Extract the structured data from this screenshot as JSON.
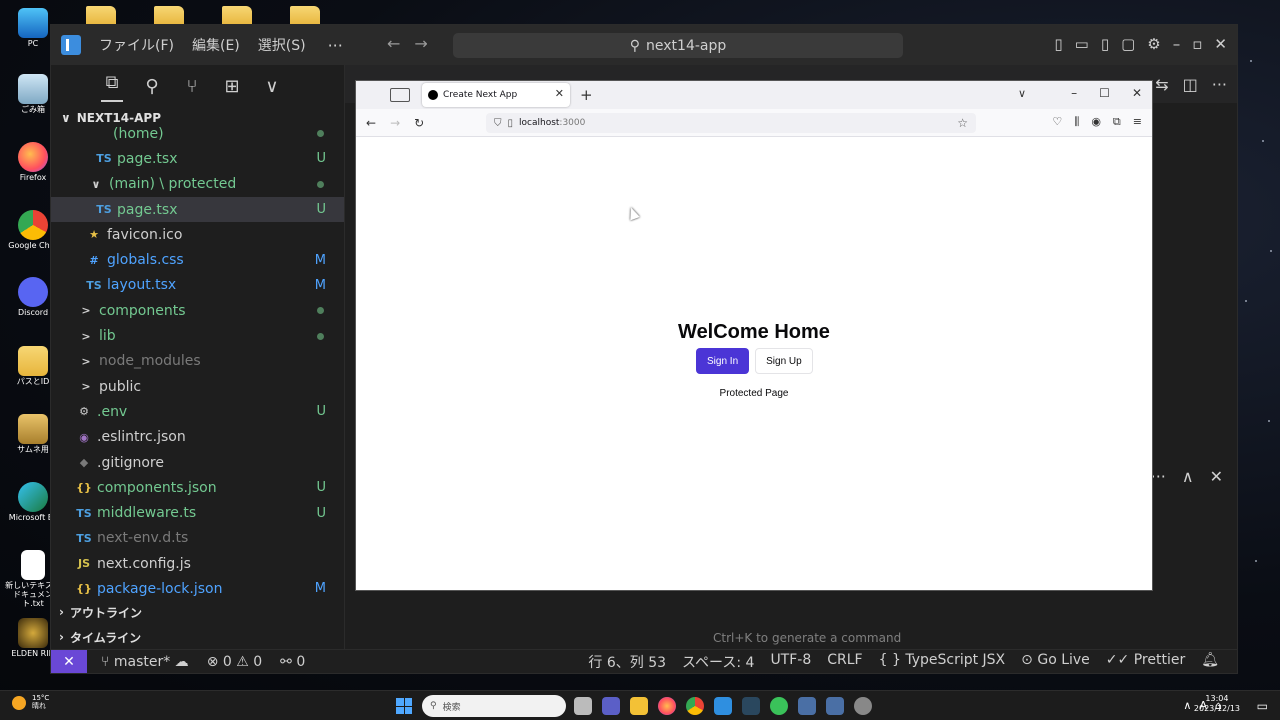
{
  "desktop": {
    "icons": [
      {
        "label": "PC"
      },
      {
        "label": "ごみ箱"
      },
      {
        "label": "Firefox"
      },
      {
        "label": "Google Chro"
      },
      {
        "label": "Discord"
      },
      {
        "label": "パスとID"
      },
      {
        "label": "サムネ用"
      },
      {
        "label": "Microsoft Ec"
      },
      {
        "label": "新しいテキスト ドキュメント.txt"
      },
      {
        "label": "ELDEN RIN"
      }
    ]
  },
  "vscode": {
    "menu": [
      "ファイル(F)",
      "編集(E)",
      "選択(S)"
    ],
    "menu_more": "···",
    "command_center": "next14-app",
    "explorer_title": "NEXT14-APP",
    "tree": [
      {
        "icon": "",
        "label": "(home)",
        "badge": "",
        "color": "green",
        "indent": 40,
        "dot": true
      },
      {
        "icon": "TS",
        "label": "page.tsx",
        "badge": "U",
        "color": "green",
        "indent": 44
      },
      {
        "icon": "∨",
        "label": "(main) \\ protected",
        "badge": "",
        "color": "green",
        "indent": 36,
        "dot": true
      },
      {
        "icon": "TS",
        "label": "page.tsx",
        "badge": "U",
        "color": "green",
        "indent": 44,
        "selected": true
      },
      {
        "icon": "★",
        "label": "favicon.ico",
        "badge": "",
        "color": "white",
        "indent": 34
      },
      {
        "icon": "#",
        "label": "globals.css",
        "badge": "M",
        "color": "blue",
        "indent": 34
      },
      {
        "icon": "TS",
        "label": "layout.tsx",
        "badge": "M",
        "color": "blue",
        "indent": 34
      },
      {
        "icon": ">",
        "label": "components",
        "badge": "",
        "color": "green",
        "indent": 26,
        "dot": true
      },
      {
        "icon": ">",
        "label": "lib",
        "badge": "",
        "color": "green",
        "indent": 26,
        "dot": true
      },
      {
        "icon": ">",
        "label": "node_modules",
        "badge": "",
        "color": "gray",
        "indent": 26
      },
      {
        "icon": ">",
        "label": "public",
        "badge": "",
        "color": "white",
        "indent": 26
      },
      {
        "icon": "⚙",
        "label": ".env",
        "badge": "U",
        "color": "green",
        "indent": 24
      },
      {
        "icon": "◉",
        "label": ".eslintrc.json",
        "badge": "",
        "color": "white",
        "indent": 24
      },
      {
        "icon": "◆",
        "label": ".gitignore",
        "badge": "",
        "color": "white",
        "indent": 24
      },
      {
        "icon": "{}",
        "label": "components.json",
        "badge": "U",
        "color": "green",
        "indent": 24
      },
      {
        "icon": "TS",
        "label": "middleware.ts",
        "badge": "U",
        "color": "green",
        "indent": 24
      },
      {
        "icon": "TS",
        "label": "next-env.d.ts",
        "badge": "",
        "color": "gray",
        "indent": 24
      },
      {
        "icon": "JS",
        "label": "next.config.js",
        "badge": "",
        "color": "white",
        "indent": 24
      },
      {
        "icon": "{}",
        "label": "package-lock.json",
        "badge": "M",
        "color": "blue",
        "indent": 24
      }
    ],
    "outline_label": "アウトライン",
    "timeline_label": "タイムライン",
    "hint": "Ctrl+K to generate a command",
    "status": {
      "branch": "master*",
      "errors": "0",
      "warnings": "0",
      "ports": "0",
      "position": "行 6、列 53",
      "spaces": "スペース: 4",
      "encoding": "UTF-8",
      "eol": "CRLF",
      "language": "TypeScript JSX",
      "golive": "Go Live",
      "prettier": "Prettier"
    }
  },
  "firefox": {
    "tab_title": "Create Next App",
    "url_host": "localhost",
    "url_port": ":3000",
    "page": {
      "heading": "WelCome Home",
      "sign_in": "Sign In",
      "sign_up": "Sign Up",
      "protected_link": "Protected Page"
    }
  },
  "taskbar": {
    "weather_temp": "15°C",
    "weather_desc": "晴れ",
    "search_placeholder": "検索",
    "time": "13:04",
    "date": "2023/12/13"
  }
}
